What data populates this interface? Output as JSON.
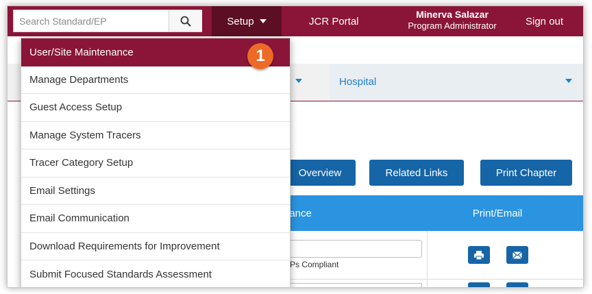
{
  "search": {
    "placeholder": "Search Standard/EP",
    "icon": "search-icon"
  },
  "nav": {
    "setup_label": "Setup",
    "jcr_portal_label": "JCR Portal",
    "user_name": "Minerva Salazar",
    "user_role": "Program Administrator",
    "signout_label": "Sign out"
  },
  "colors": {
    "brand": "#8a1538",
    "brand_dark": "#5b0e24",
    "accent_blue": "#1565a7",
    "table_header": "#2b94e0",
    "badge": "#ee6a27"
  },
  "setup_menu": {
    "items": [
      {
        "label": "User/Site Maintenance",
        "active": true
      },
      {
        "label": "Manage Departments"
      },
      {
        "label": "Guest Access Setup"
      },
      {
        "label": "Manage System Tracers"
      },
      {
        "label": "Tracer Category Setup"
      },
      {
        "label": "Email Settings"
      },
      {
        "label": "Email Communication"
      },
      {
        "label": "Download Requirements for Improvement"
      },
      {
        "label": "Submit Focused Standards Assessment"
      }
    ]
  },
  "step_badge": "1",
  "filters": {
    "program_value": "Hospital"
  },
  "actions": {
    "overview_label": "Overview",
    "related_links_label": "Related Links",
    "print_chapter_label": "Print Chapter"
  },
  "table": {
    "columns": {
      "compliance": "iance",
      "print_email": "Print/Email"
    },
    "row1": {
      "compliance_text": "EPs Compliant"
    },
    "icons": {
      "print": "printer-icon",
      "email": "envelope-icon"
    }
  }
}
